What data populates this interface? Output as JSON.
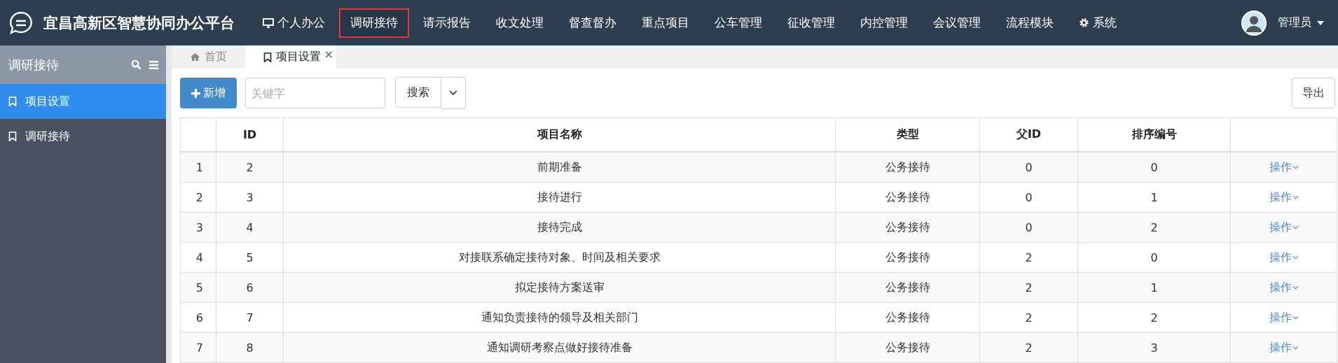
{
  "app": {
    "title": "宜昌高新区智慧协同办公平台"
  },
  "nav": [
    {
      "label": "个人办公",
      "kind": "desktop",
      "selected": false
    },
    {
      "label": "调研接待",
      "kind": "plain",
      "selected": true
    },
    {
      "label": "请示报告",
      "kind": "plain",
      "selected": false
    },
    {
      "label": "收文处理",
      "kind": "plain",
      "selected": false
    },
    {
      "label": "督查督办",
      "kind": "plain",
      "selected": false
    },
    {
      "label": "重点项目",
      "kind": "plain",
      "selected": false
    },
    {
      "label": "公车管理",
      "kind": "plain",
      "selected": false
    },
    {
      "label": "征收管理",
      "kind": "plain",
      "selected": false
    },
    {
      "label": "内控管理",
      "kind": "plain",
      "selected": false
    },
    {
      "label": "会议管理",
      "kind": "plain",
      "selected": false
    },
    {
      "label": "流程模块",
      "kind": "plain",
      "selected": false
    },
    {
      "label": "系统",
      "kind": "gear",
      "selected": false
    }
  ],
  "user": {
    "name": "管理员"
  },
  "sidebar": {
    "title": "调研接待",
    "items": [
      {
        "label": "项目设置",
        "selected": true
      },
      {
        "label": "调研接待",
        "selected": false
      }
    ]
  },
  "tabs": [
    {
      "label": "首页",
      "kind": "home",
      "selected": false
    },
    {
      "label": "项目设置",
      "kind": "page",
      "selected": true,
      "close": "×"
    }
  ],
  "toolbar": {
    "add": "新增",
    "search": {
      "placeholder": "关键字"
    },
    "search_button": "搜索",
    "export": "导出"
  },
  "table": {
    "columns": [
      "",
      "ID",
      "项目名称",
      "类型",
      "父ID",
      "排序编号",
      ""
    ],
    "rows": [
      {
        "cells": [
          "1",
          "2",
          "前期准备",
          "公务接待",
          "0",
          "0"
        ],
        "action": "操作"
      },
      {
        "cells": [
          "2",
          "3",
          "接待进行",
          "公务接待",
          "0",
          "1"
        ],
        "action": "操作"
      },
      {
        "cells": [
          "3",
          "4",
          "接待完成",
          "公务接待",
          "0",
          "2"
        ],
        "action": "操作"
      },
      {
        "cells": [
          "4",
          "5",
          "对接联系确定接待对象、时间及相关要求",
          "公务接待",
          "2",
          "0"
        ],
        "action": "操作"
      },
      {
        "cells": [
          "5",
          "6",
          "拟定接待方案送审",
          "公务接待",
          "2",
          "1"
        ],
        "action": "操作"
      },
      {
        "cells": [
          "6",
          "7",
          "通知负责接待的领导及相关部门",
          "公务接待",
          "2",
          "2"
        ],
        "action": "操作"
      },
      {
        "cells": [
          "7",
          "8",
          "通知调研考察点做好接待准备",
          "公务接待",
          "2",
          "3"
        ],
        "action": "操作"
      }
    ]
  }
}
